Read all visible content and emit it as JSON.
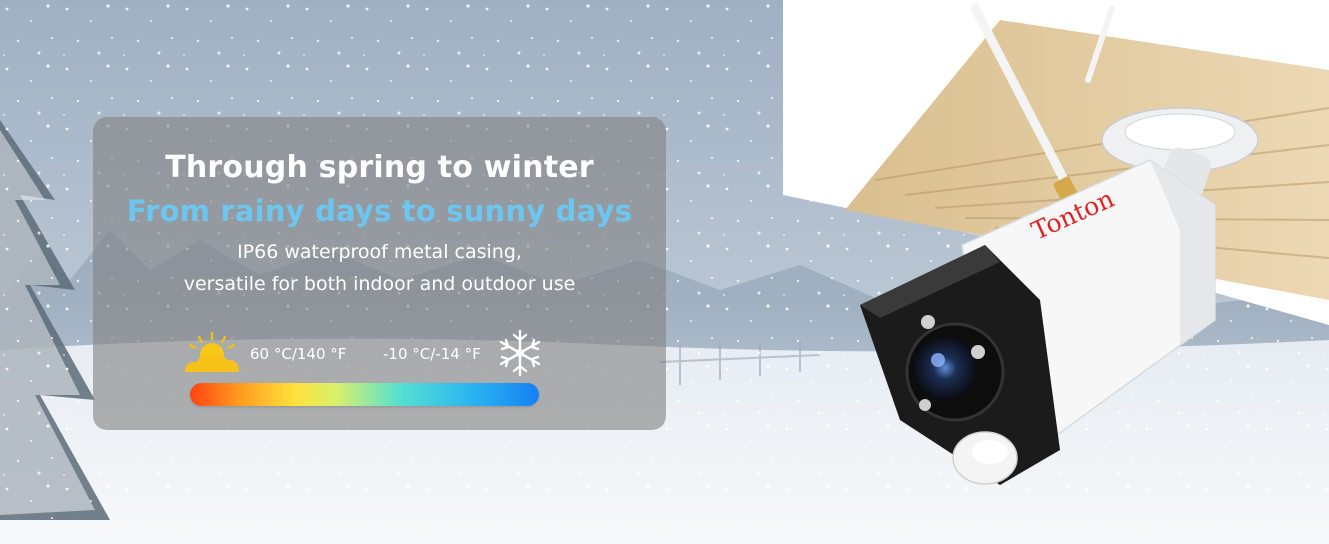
{
  "banner": {
    "headline": "Through spring to winter",
    "subheadline": "From rainy days to sunny days",
    "description_line1": "IP66 waterproof metal casing,",
    "description_line2": "versatile for both indoor and outdoor use",
    "high_temp": "60 °C/140 °F",
    "low_temp": "-10 °C/-14 °F",
    "hot_icon": "sun-cloud-icon",
    "cold_icon": "snowflake-icon",
    "temperature_range_fraction": 1.0
  },
  "product": {
    "brand_logo": "Tonton"
  },
  "colors": {
    "headline": "#ffffff",
    "subheadline": "#6cc6ef",
    "gradient_hot": "#ff4411",
    "gradient_cold": "#1780f4",
    "brand": "#e02322"
  }
}
